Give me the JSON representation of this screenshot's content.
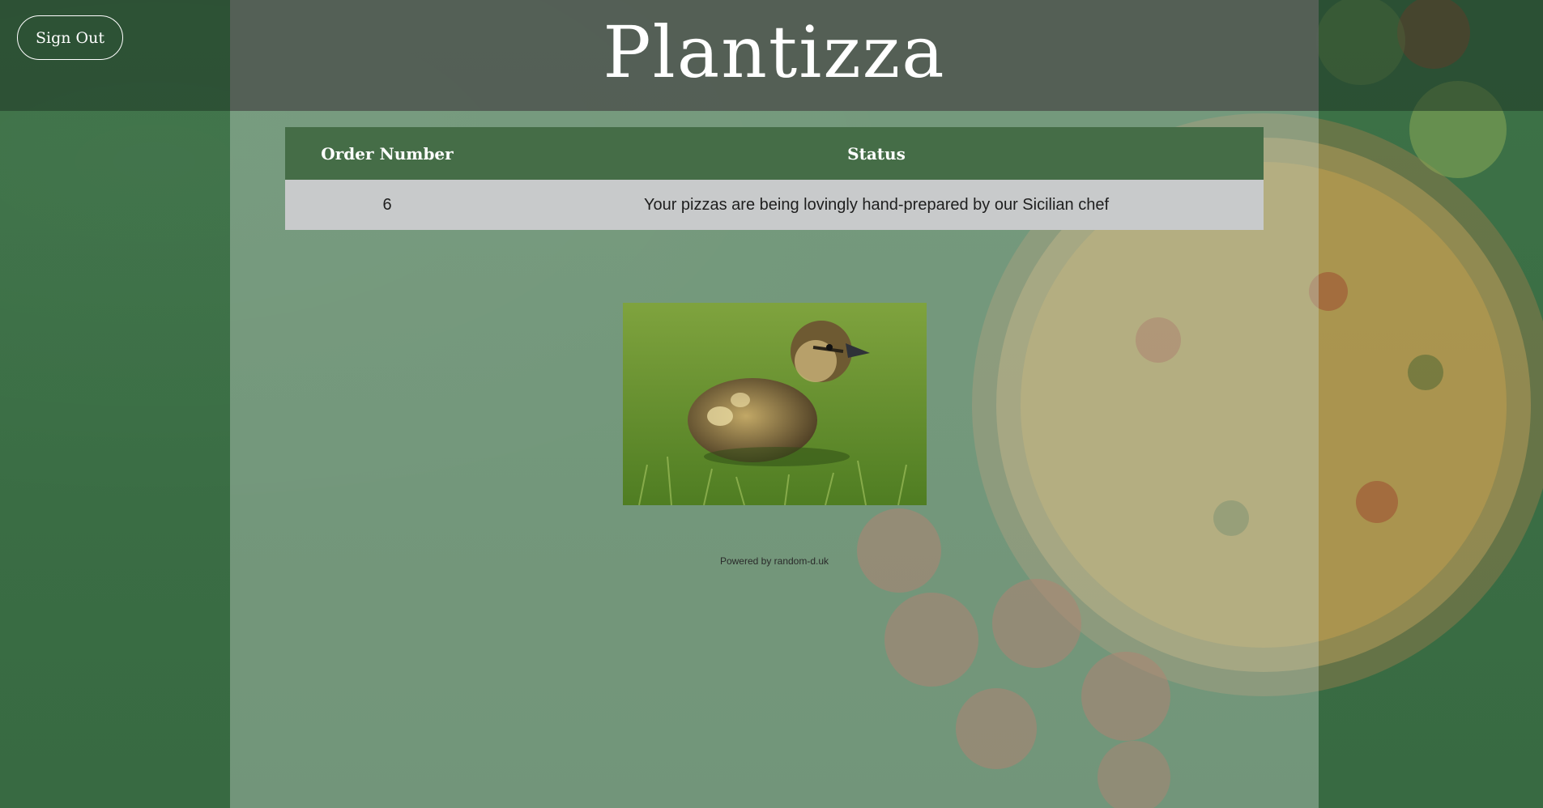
{
  "header": {
    "brand": "Plantizza",
    "sign_out_label": "Sign Out"
  },
  "orders_table": {
    "columns": [
      "Order Number",
      "Status"
    ],
    "rows": [
      {
        "order_number": "6",
        "status": "Your pizzas are being lovingly hand-prepared by our Sicilian chef"
      }
    ]
  },
  "illustration": {
    "icon": "duckling-photo"
  },
  "footer": {
    "powered_by": "Powered by random-d.uk"
  },
  "colors": {
    "background_green": "#3a6e45",
    "table_header": "#456d47",
    "table_row": "#c8cacb",
    "text_white": "#ffffff"
  }
}
